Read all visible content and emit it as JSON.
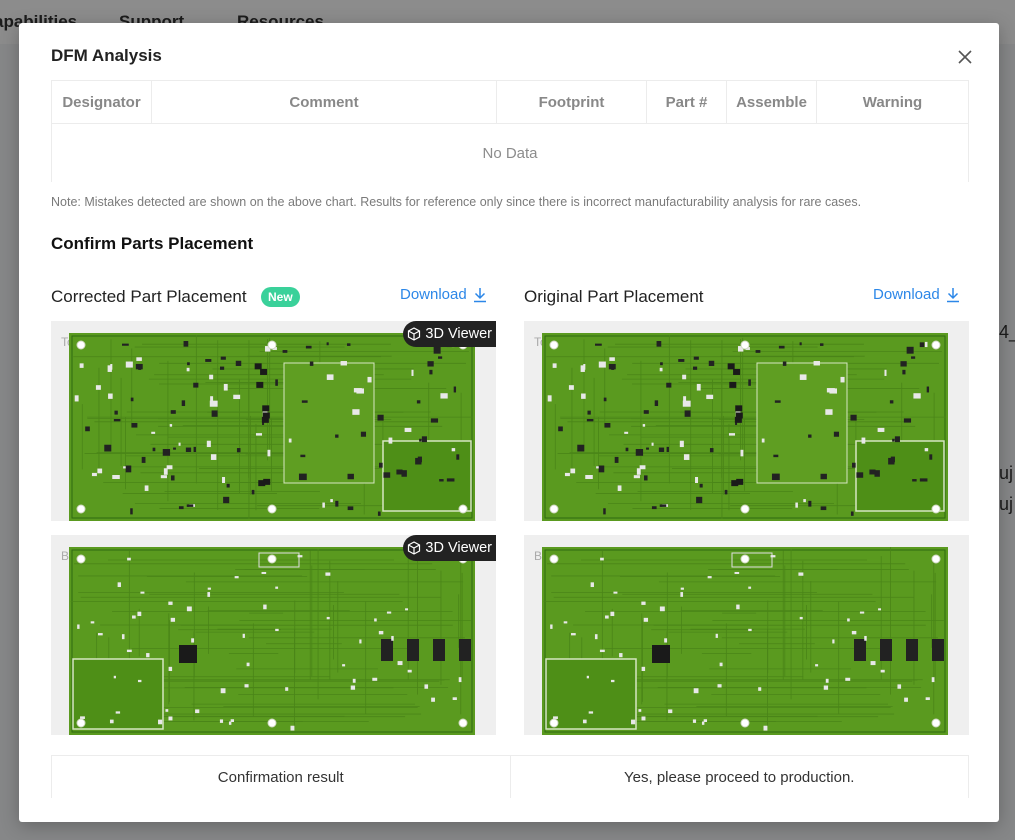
{
  "background": {
    "nav": [
      "apabilities",
      "Support",
      "Resources"
    ],
    "side_texts": [
      "4_",
      "uj",
      "uj"
    ]
  },
  "modal": {
    "title": "DFM Analysis",
    "close_icon": "close-icon",
    "table": {
      "columns": [
        "Designator",
        "Comment",
        "Footprint",
        "Part #",
        "Assemble",
        "Warning"
      ],
      "empty_text": "No Data"
    },
    "note": "Note: Mistakes detected are shown on the above chart. Results for reference only since there is incorrect manufacturability analysis for rare cases.",
    "section_title": "Confirm Parts Placement",
    "corrected": {
      "title": "Corrected Part Placement",
      "badge": "New",
      "download": "Download",
      "top_label": "To",
      "bottom_label": "Bo",
      "viewer_label": "3D Viewer"
    },
    "original": {
      "title": "Original Part Placement",
      "download": "Download",
      "top_label": "To",
      "bottom_label": "Bo"
    },
    "confirmation": {
      "label": "Confirmation result",
      "value": "Yes, please proceed to production."
    }
  },
  "colors": {
    "accent": "#2c87e8",
    "badge": "#3ad19a",
    "board": "#5a9a1f"
  }
}
